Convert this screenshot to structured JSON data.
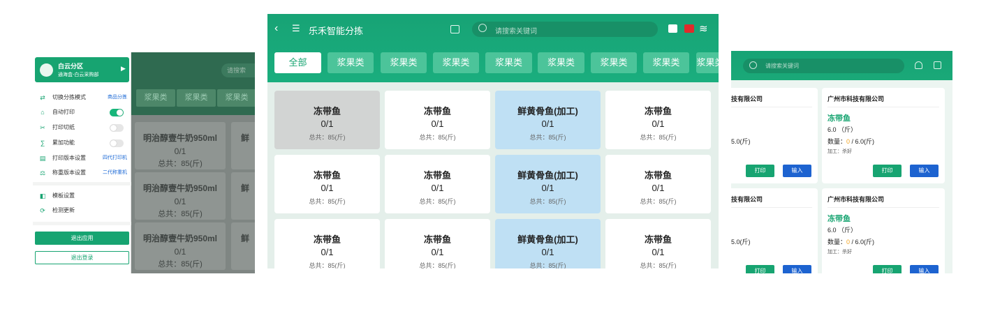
{
  "left": {
    "bg_search_placeholder": "请搜索",
    "bg_tabs": [
      "浆果类",
      "浆果类",
      "浆果类"
    ],
    "bg_cards": [
      {
        "name": "明治醇壹牛奶950ml",
        "count": "0/1",
        "total": "总共：85(斤)"
      },
      {
        "name": "明治醇壹牛奶950ml",
        "count": "0/1",
        "total": "总共：85(斤)"
      },
      {
        "name": "明治醇壹牛奶950ml",
        "count": "0/1",
        "total": "总共：85(斤)"
      }
    ],
    "bg_card_edge": "鲜",
    "drawer": {
      "zone": "白云分区",
      "subtitle": "通海盒-白云采购部",
      "menu": [
        {
          "icon": "switch-icon",
          "label": "切换分拣模式",
          "value": "商品分拣"
        },
        {
          "icon": "print-icon",
          "label": "自动打印",
          "toggle": true
        },
        {
          "icon": "cut-icon",
          "label": "打印切纸",
          "toggle": false
        },
        {
          "icon": "sum-icon",
          "label": "累加功能",
          "toggle": false
        },
        {
          "icon": "printer-icon",
          "label": "打印版本设置",
          "value": "四代打印机"
        },
        {
          "icon": "scale-icon",
          "label": "称重版本设置",
          "value": "二代称重机"
        }
      ],
      "menu2": [
        {
          "icon": "template-icon",
          "label": "模板设置"
        },
        {
          "icon": "update-icon",
          "label": "检测更新"
        }
      ],
      "exit_app": "退出应用",
      "logout": "退出登录"
    }
  },
  "mid": {
    "title": "乐禾智能分拣",
    "search_placeholder": "请搜索关键词",
    "tabs": [
      "全部",
      "浆果类",
      "浆果类",
      "浆果类",
      "浆果类",
      "浆果类",
      "浆果类",
      "浆果类",
      "浆果类"
    ],
    "cards": [
      {
        "name": "冻带鱼",
        "count": "0/1",
        "total": "总共：85(斤)",
        "style": "gray"
      },
      {
        "name": "冻带鱼",
        "count": "0/1",
        "total": "总共：85(斤)",
        "style": "white"
      },
      {
        "name": "鲜黄骨鱼(加工)",
        "count": "0/1",
        "total": "总共：85(斤)",
        "style": "blue"
      },
      {
        "name": "冻带鱼",
        "count": "0/1",
        "total": "总共：85(斤)",
        "style": "white"
      },
      {
        "name": "冻带鱼",
        "count": "0/1",
        "total": "总共：85(斤)",
        "style": "white"
      },
      {
        "name": "冻带鱼",
        "count": "0/1",
        "total": "总共：85(斤)",
        "style": "white"
      },
      {
        "name": "鲜黄骨鱼(加工)",
        "count": "0/1",
        "total": "总共：85(斤)",
        "style": "blue"
      },
      {
        "name": "冻带鱼",
        "count": "0/1",
        "total": "总共：85(斤)",
        "style": "white"
      },
      {
        "name": "冻带鱼",
        "count": "0/1",
        "total": "总共：85(斤)",
        "style": "white"
      },
      {
        "name": "冻带鱼",
        "count": "0/1",
        "total": "总共：85(斤)",
        "style": "white"
      },
      {
        "name": "鲜黄骨鱼(加工)",
        "count": "0/1",
        "total": "总共：85(斤)",
        "style": "blue"
      },
      {
        "name": "冻带鱼",
        "count": "0/1",
        "total": "总共：85(斤)",
        "style": "white"
      }
    ]
  },
  "right": {
    "search_placeholder": "请搜索关键词",
    "cards": [
      {
        "company": "技有限公司",
        "fish": "",
        "weight": "",
        "qty_prefix": "",
        "qty_done": "",
        "qty_rest": "5.0(斤)",
        "process": "",
        "print": "打印",
        "input": "输入"
      },
      {
        "company": "广州市科技有限公司",
        "fish": "冻带鱼",
        "weight": "6.0 （斤）",
        "qty_prefix": "数量：",
        "qty_done": "0",
        "qty_rest": " / 6.0(斤)",
        "process": "加工：杀好",
        "print": "打印",
        "input": "输入"
      },
      {
        "company": "技有限公司",
        "fish": "",
        "weight": "",
        "qty_prefix": "",
        "qty_done": "",
        "qty_rest": "5.0(斤)",
        "process": "",
        "print": "打印",
        "input": "输入"
      },
      {
        "company": "广州市科技有限公司",
        "fish": "冻带鱼",
        "weight": "6.0 （斤）",
        "qty_prefix": "数量：",
        "qty_done": "0",
        "qty_rest": " / 6.0(斤)",
        "process": "加工：杀好",
        "print": "打印",
        "input": "输入"
      }
    ]
  }
}
